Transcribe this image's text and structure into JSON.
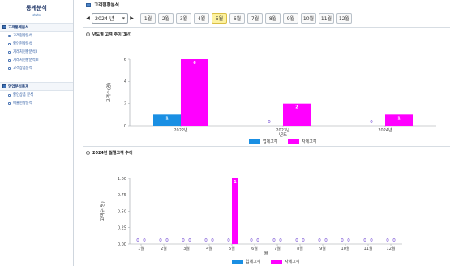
{
  "sidebar": {
    "title": "통계분석",
    "subtitle": "stats",
    "groups": [
      {
        "title": "고객통계분석",
        "items": [
          "고객현황분석",
          "할인현황분석",
          "거래처현황분석 I",
          "거래처현황분석 II",
          "고객상품분석"
        ]
      },
      {
        "title": "영업분석통계",
        "items": [
          "할인상품 분석",
          "매출현황분석"
        ]
      }
    ]
  },
  "header": {
    "title": "고객현황분석"
  },
  "toolbar": {
    "prev": "◀",
    "next": "▶",
    "year": "2024 년",
    "months": [
      "1월",
      "2월",
      "3월",
      "4월",
      "5월",
      "6월",
      "7월",
      "8월",
      "9월",
      "10월",
      "11월",
      "12월"
    ],
    "active_month_index": 4
  },
  "panels": {
    "yearly_title": "년도별 고객 추이(3년)",
    "monthly_title": "2024년 월별고객 추이",
    "toggle_icon": "plus-circle-icon"
  },
  "colors": {
    "existing": "#1a8fe3",
    "self": "#ff00ff",
    "active_month": "#fdf2a0"
  },
  "chart_data": [
    {
      "type": "bar",
      "categories": [
        "2022년",
        "2023년",
        "2024년"
      ],
      "series": [
        {
          "name": "업체고객",
          "values": [
            1,
            0,
            0
          ]
        },
        {
          "name": "자체고객",
          "values": [
            6,
            2,
            1
          ]
        }
      ],
      "xlabel": "년도",
      "ylabel": "고객수(명)",
      "ylim": [
        0,
        6
      ],
      "yticks": [
        "0",
        "2",
        "4",
        "6"
      ],
      "legend": "bottom",
      "grid": false
    },
    {
      "type": "bar",
      "categories": [
        "1월",
        "2월",
        "3월",
        "4월",
        "5월",
        "6월",
        "7월",
        "8월",
        "9월",
        "10월",
        "11월",
        "12월"
      ],
      "series": [
        {
          "name": "업체고객",
          "values": [
            0,
            0,
            0,
            0,
            0,
            0,
            0,
            0,
            0,
            0,
            0,
            0
          ]
        },
        {
          "name": "자체고객",
          "values": [
            0,
            0,
            0,
            0,
            1,
            0,
            0,
            0,
            0,
            0,
            0,
            0
          ]
        }
      ],
      "xlabel": "월",
      "ylabel": "고객수(명)",
      "ylim": [
        0,
        1
      ],
      "yticks": [
        "0.00",
        "0.25",
        "0.50",
        "0.75",
        "1.00"
      ],
      "legend": "bottom",
      "grid": false
    }
  ]
}
